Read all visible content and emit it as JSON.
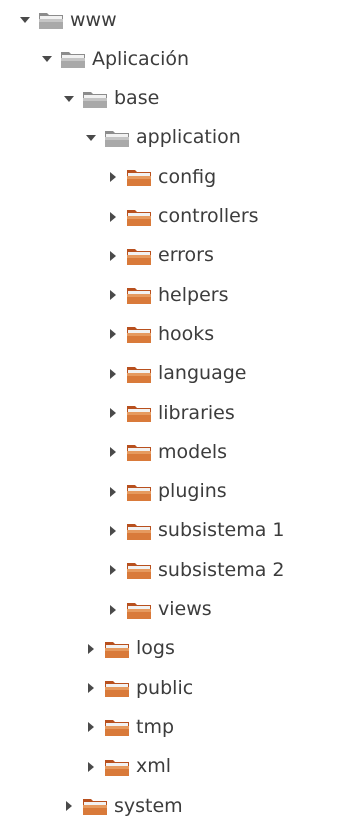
{
  "colors": {
    "text": "#3c3c3c",
    "arrow": "#4a4a4a",
    "folder_gray": "#8c8c8c",
    "folder_gray_light": "#cfcfcf",
    "folder_orange": "#b8501e",
    "folder_orange_light": "#e9a56c"
  },
  "tree": [
    {
      "label": "www",
      "expanded": true,
      "folder_style": "gray",
      "icon": "folder-icon"
    },
    {
      "label": "Aplicación",
      "expanded": true,
      "folder_style": "gray",
      "icon": "folder-icon"
    },
    {
      "label": "base",
      "expanded": true,
      "folder_style": "gray",
      "icon": "folder-icon"
    },
    {
      "label": "application",
      "expanded": true,
      "folder_style": "gray",
      "icon": "folder-icon"
    },
    {
      "label": "config",
      "expanded": false,
      "folder_style": "orange",
      "icon": "folder-icon"
    },
    {
      "label": "controllers",
      "expanded": false,
      "folder_style": "orange",
      "icon": "folder-icon"
    },
    {
      "label": "errors",
      "expanded": false,
      "folder_style": "orange",
      "icon": "folder-icon"
    },
    {
      "label": "helpers",
      "expanded": false,
      "folder_style": "orange",
      "icon": "folder-icon"
    },
    {
      "label": "hooks",
      "expanded": false,
      "folder_style": "orange",
      "icon": "folder-icon"
    },
    {
      "label": "language",
      "expanded": false,
      "folder_style": "orange",
      "icon": "folder-icon"
    },
    {
      "label": "libraries",
      "expanded": false,
      "folder_style": "orange",
      "icon": "folder-icon"
    },
    {
      "label": "models",
      "expanded": false,
      "folder_style": "orange",
      "icon": "folder-icon"
    },
    {
      "label": "plugins",
      "expanded": false,
      "folder_style": "orange",
      "icon": "folder-icon"
    },
    {
      "label": "subsistema 1",
      "expanded": false,
      "folder_style": "orange",
      "icon": "folder-icon"
    },
    {
      "label": "subsistema 2",
      "expanded": false,
      "folder_style": "orange",
      "icon": "folder-icon"
    },
    {
      "label": "views",
      "expanded": false,
      "folder_style": "orange",
      "icon": "folder-icon"
    },
    {
      "label": "logs",
      "expanded": false,
      "folder_style": "orange",
      "icon": "folder-icon"
    },
    {
      "label": "public",
      "expanded": false,
      "folder_style": "orange",
      "icon": "folder-icon"
    },
    {
      "label": "tmp",
      "expanded": false,
      "folder_style": "orange",
      "icon": "folder-icon"
    },
    {
      "label": "xml",
      "expanded": false,
      "folder_style": "orange",
      "icon": "folder-icon"
    },
    {
      "label": "system",
      "expanded": false,
      "folder_style": "orange",
      "icon": "folder-icon"
    }
  ]
}
